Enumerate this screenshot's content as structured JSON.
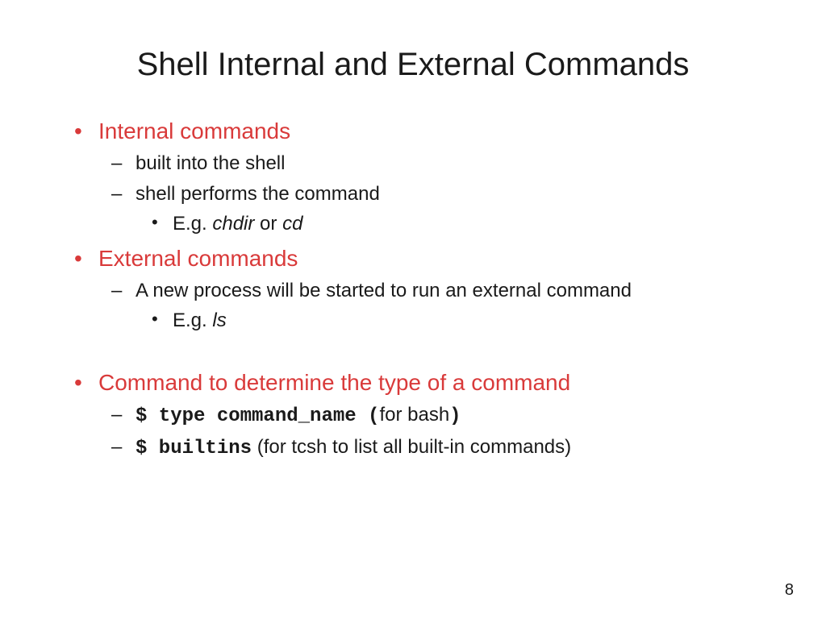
{
  "title": "Shell Internal and External Commands",
  "bullets": {
    "b1": {
      "label": "Internal commands",
      "sub1": "built into the shell",
      "sub2": "shell performs the command",
      "ex_prefix": "E.g. ",
      "ex_ital1": "chdir",
      "ex_mid": " or ",
      "ex_ital2": "cd"
    },
    "b2": {
      "label": "External commands",
      "sub1": "A new process will be started to run an external command",
      "ex_prefix": "E.g. ",
      "ex_ital1": "ls"
    },
    "b3": {
      "label": "Command to determine the type of a command",
      "cmd1_code": "$ type command_name (",
      "cmd1_tail": "for bash",
      "cmd1_close": ")",
      "cmd2_code": "$ builtins",
      "cmd2_tail": " (for tcsh to list all built-in commands)"
    }
  },
  "page_number": "8"
}
